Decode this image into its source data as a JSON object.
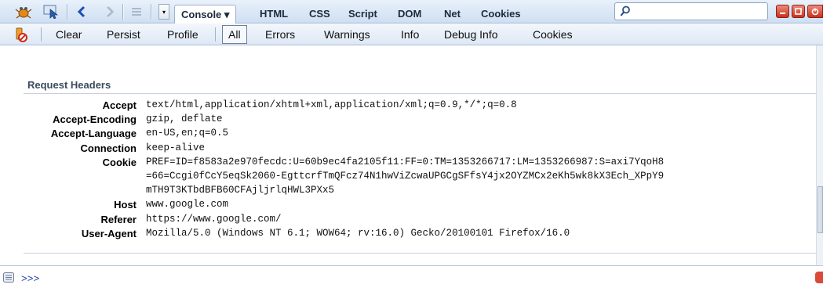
{
  "toolbar": {
    "tabs": [
      {
        "label": "Console ▾",
        "active": true
      },
      {
        "label": "HTML"
      },
      {
        "label": "CSS"
      },
      {
        "label": "Script"
      },
      {
        "label": "DOM"
      },
      {
        "label": "Net"
      },
      {
        "label": "Cookies"
      }
    ],
    "icons": [
      "firebug-icon",
      "inspect-icon",
      "back-icon",
      "forward-icon",
      "list-icon",
      "dropdown-icon",
      "search-icon"
    ],
    "window_buttons": [
      "minimize-button",
      "restore-button",
      "close-button"
    ]
  },
  "console_toolbar": {
    "items": [
      "Clear",
      "Persist",
      "Profile",
      "All",
      "Errors",
      "Warnings",
      "Info",
      "Debug Info",
      "Cookies"
    ],
    "active": "All"
  },
  "request_headers": {
    "title": "Request Headers",
    "rows": [
      {
        "name": "Accept",
        "value": "text/html,application/xhtml+xml,application/xml;q=0.9,*/*;q=0.8"
      },
      {
        "name": "Accept-Encoding",
        "value": "gzip, deflate"
      },
      {
        "name": "Accept-Language",
        "value": "en-US,en;q=0.5"
      },
      {
        "name": "Connection",
        "value": "keep-alive"
      },
      {
        "name": "Cookie",
        "value": "PREF=ID=f8583a2e970fecdc:U=60b9ec4fa2105f11:FF=0:TM=1353266717:LM=1353266987:S=axi7YqoH8"
      },
      {
        "name": "",
        "value": "=66=Ccgi0fCcY5eqSk2060-EgttcrfTmQFcz74N1hwViZcwaUPGCgSFfsY4jx2OYZMCx2eKh5wk8kX3Ech_XPpY9"
      },
      {
        "name": "",
        "value": "mTH9T3KTbdBFB60CFAjljrlqHWL3PXx5"
      },
      {
        "name": "Host",
        "value": "www.google.com"
      },
      {
        "name": "Referer",
        "value": "https://www.google.com/"
      },
      {
        "name": "User-Agent",
        "value": "Mozilla/5.0 (Windows NT 6.1; WOW64; rv:16.0) Gecko/20100101 Firefox/16.0"
      }
    ]
  },
  "command_line": {
    "prompt": ">>>"
  },
  "colors": {
    "accent": "#1f3f9f",
    "toolbar": "#cfdff2",
    "close": "#c8321e"
  }
}
